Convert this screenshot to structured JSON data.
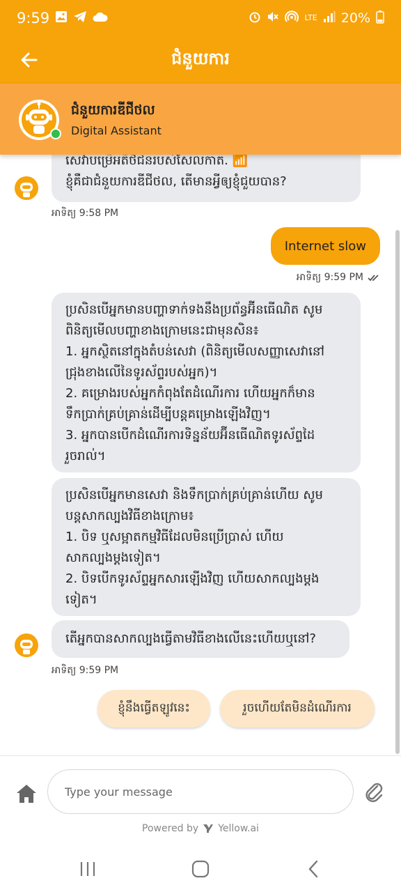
{
  "status_bar": {
    "time": "9:59",
    "battery": "20%",
    "network": "LTE",
    "icons_left": [
      "gallery-icon",
      "telegram-icon",
      "cloud-icon"
    ],
    "icons_right": [
      "alarm-icon",
      "mute-icon",
      "hotspot-icon",
      "lte-icon",
      "signal-icon",
      "battery-icon"
    ]
  },
  "app_bar": {
    "title": "ជំនួយការ"
  },
  "bot": {
    "name": "ជំនួយការឌីជីថល",
    "subtitle": "Digital Assistant",
    "online": true
  },
  "messages": {
    "m1": {
      "lines": [
        "សេវាបម្រើអតិថិជនរបស់សែលកាត. 📶",
        "ខ្ញុំគឺជាជំនួយការឌីជីថល, តើមានអ្វីឲ្យខ្ញុំជួយបាន?"
      ],
      "time": "អាទិត្យ 9:58 PM"
    },
    "m2": {
      "text": "Internet slow",
      "time": "អាទិត្យ 9:59 PM"
    },
    "m3": {
      "lines": [
        "ប្រសិនបើអ្នកមានបញ្ហាទាក់ទងនឹងប្រព័ន្ធអ៊ីនធើណិត សូម",
        "ពិនិត្យមើលបញ្ហាខាងក្រោមនេះជាមុនសិន៖",
        "1. អ្នកស្ថិតនៅក្នុងតំបន់សេវា (ពិនិត្យមើលសញ្ញាសេវានៅ",
        "ជ្រុងខាងលើនៃទូរស័ព្ទរបស់អ្នក)។",
        "2. គម្រោងរបស់អ្នកកំពុងតែដំណើរការ ហើយអ្នកក៏មាន",
        "ទឹកប្រាក់គ្រប់គ្រាន់ដើម្បីបន្តគម្រោងឡើងវិញ។",
        "3. អ្នកបានបើកដំណើរការទិន្នន័យអ៊ីនធើណិតទូរស័ព្ទដៃ",
        "រួចរាល់។"
      ]
    },
    "m4": {
      "lines": [
        "ប្រសិនបើអ្នកមានសេវា និងទឹកប្រាក់គ្រប់គ្រាន់ហើយ សូម",
        "បន្តសាកល្បងវិធីខាងក្រោម៖",
        "1. បិទ ឬសម្អាតកម្មវិធីដែលមិនប្រើប្រាស់ ហើយ",
        "សាកល្បងម្តងទៀត។",
        "2. បិទបើកទូរស័ព្ទអ្នកសារឡើងវិញ ហើយសាកល្បងម្តង",
        "ទៀត។"
      ]
    },
    "m5": {
      "text": "តើអ្នកបានសាកល្បងធ្វើតាមវិធីខាងលើនេះហើយឬនៅ?",
      "time": "អាទិត្យ 9:59 PM"
    }
  },
  "quick_replies": [
    "ខ្ញុំនឹងធ្វើតឡូវនេះ",
    "រួចហើយតែមិនដំណើរការ"
  ],
  "input": {
    "placeholder": "Type your message"
  },
  "footer": {
    "powered_by": "Powered by",
    "brand": "Yellow.ai"
  },
  "colors": {
    "accent": "#f7a30a",
    "header": "#f9a642",
    "bubble_in": "#e8eaed",
    "quick_reply": "#fde7c8"
  }
}
